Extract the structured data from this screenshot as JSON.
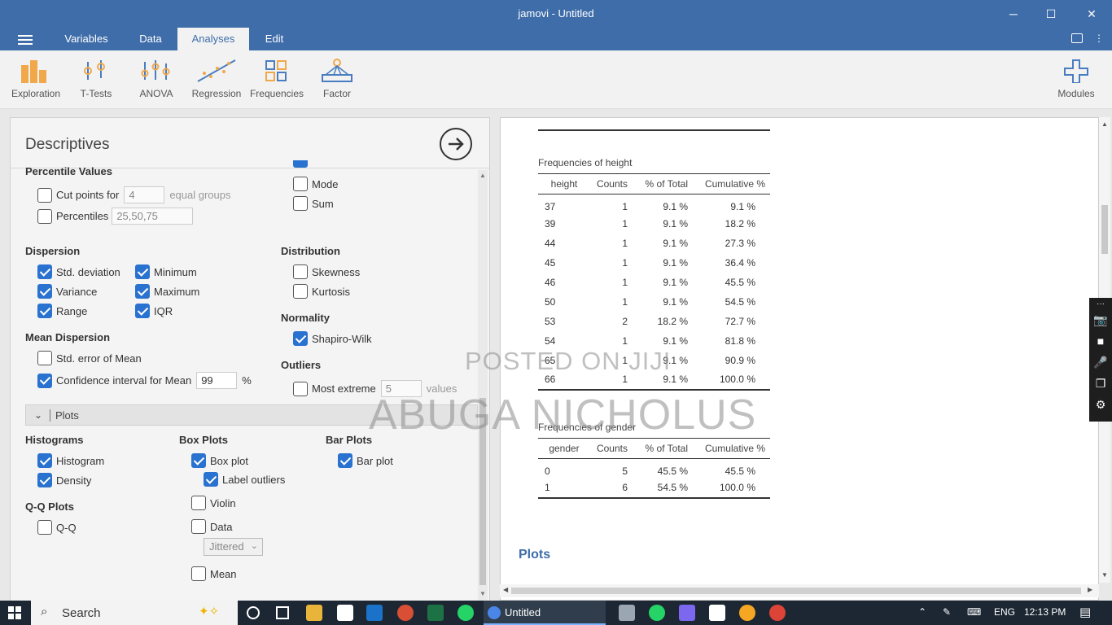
{
  "window": {
    "title": "jamovi - Untitled",
    "minimize": "─",
    "maximize": "☐",
    "close": "✕"
  },
  "menu": {
    "tabs": [
      "Variables",
      "Data",
      "Analyses",
      "Edit"
    ],
    "active_tab": "Analyses"
  },
  "ribbon": {
    "buttons": [
      "Exploration",
      "T-Tests",
      "ANOVA",
      "Regression",
      "Frequencies",
      "Factor"
    ],
    "modules": "Modules",
    "accent": "#3e6da9",
    "icon_orange": "#f0a84a",
    "icon_blue": "#4a7dbf"
  },
  "options": {
    "title": "Descriptives",
    "percentile_values": {
      "heading": "Percentile Values",
      "cut_points_label": "Cut points for",
      "cut_points_value": "4",
      "cut_points_suffix": "equal groups",
      "percentiles_label": "Percentiles",
      "percentiles_value": "25,50,75"
    },
    "central": {
      "mode": "Mode",
      "sum": "Sum"
    },
    "dispersion": {
      "heading": "Dispersion",
      "std_deviation": "Std. deviation",
      "variance": "Variance",
      "range": "Range",
      "minimum": "Minimum",
      "maximum": "Maximum",
      "iqr": "IQR"
    },
    "distribution": {
      "heading": "Distribution",
      "skewness": "Skewness",
      "kurtosis": "Kurtosis"
    },
    "normality": {
      "heading": "Normality",
      "shapiro_wilk": "Shapiro-Wilk"
    },
    "mean_dispersion": {
      "heading": "Mean Dispersion",
      "std_error": "Std. error of Mean",
      "ci_label": "Confidence interval for Mean",
      "ci_value": "99",
      "ci_unit": "%"
    },
    "outliers": {
      "heading": "Outliers",
      "most_extreme_label": "Most extreme",
      "most_extreme_value": "5",
      "most_extreme_suffix": "values"
    },
    "plots": {
      "bar_label": "Plots",
      "histograms": {
        "heading": "Histograms",
        "histogram": "Histogram",
        "density": "Density"
      },
      "qq": {
        "heading": "Q-Q Plots",
        "qq": "Q-Q"
      },
      "box": {
        "heading": "Box Plots",
        "box_plot": "Box plot",
        "label_outliers": "Label outliers",
        "violin": "Violin",
        "data": "Data",
        "jitter": "Jittered",
        "mean": "Mean"
      },
      "bar": {
        "heading": "Bar Plots",
        "bar_plot": "Bar plot"
      }
    }
  },
  "results": {
    "height_table": {
      "caption": "Frequencies of height",
      "columns": [
        "height",
        "Counts",
        "% of Total",
        "Cumulative %"
      ],
      "rows": [
        [
          "37",
          "1",
          "9.1 %",
          "9.1 %"
        ],
        [
          "39",
          "1",
          "9.1 %",
          "18.2 %"
        ],
        [
          "44",
          "1",
          "9.1 %",
          "27.3 %"
        ],
        [
          "45",
          "1",
          "9.1 %",
          "36.4 %"
        ],
        [
          "46",
          "1",
          "9.1 %",
          "45.5 %"
        ],
        [
          "50",
          "1",
          "9.1 %",
          "54.5 %"
        ],
        [
          "53",
          "2",
          "18.2 %",
          "72.7 %"
        ],
        [
          "54",
          "1",
          "9.1 %",
          "81.8 %"
        ],
        [
          "65",
          "1",
          "9.1 %",
          "90.9 %"
        ],
        [
          "66",
          "1",
          "9.1 %",
          "100.0 %"
        ]
      ]
    },
    "gender_table": {
      "caption": "Frequencies of gender",
      "columns": [
        "gender",
        "Counts",
        "% of Total",
        "Cumulative %"
      ],
      "rows": [
        [
          "0",
          "5",
          "45.5 %",
          "45.5 %"
        ],
        [
          "1",
          "6",
          "54.5 %",
          "100.0 %"
        ]
      ]
    },
    "plots_heading": "Plots"
  },
  "watermark": {
    "line1": "POSTED ON JIJI",
    "line2": "ABUGA NICHOLUS"
  },
  "taskbar": {
    "search": "Search",
    "active_app": "Untitled",
    "language": "ENG",
    "time": "12:13 PM"
  }
}
